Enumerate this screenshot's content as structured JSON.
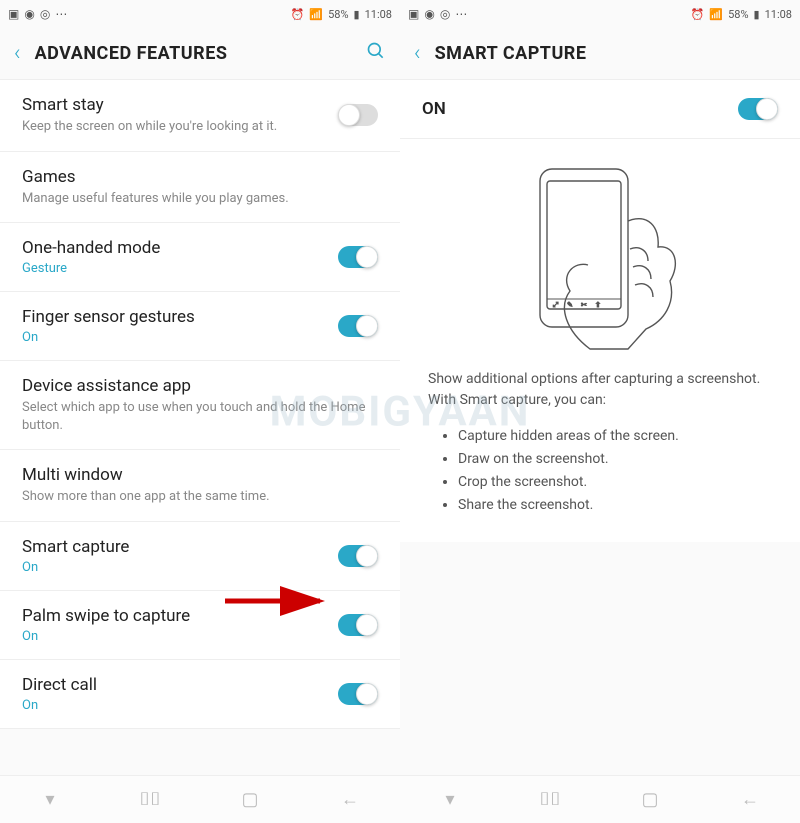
{
  "status": {
    "battery": "58%",
    "time": "11:08"
  },
  "left": {
    "title": "ADVANCED FEATURES",
    "items": [
      {
        "label": "Smart stay",
        "desc": "Keep the screen on while you're looking at it.",
        "toggle": "off"
      },
      {
        "label": "Games",
        "desc": "Manage useful features while you play games."
      },
      {
        "label": "One-handed mode",
        "sub": "Gesture",
        "toggle": "on"
      },
      {
        "label": "Finger sensor gestures",
        "sub": "On",
        "toggle": "on"
      },
      {
        "label": "Device assistance app",
        "desc": "Select which app to use when you touch and hold the Home button."
      },
      {
        "label": "Multi window",
        "desc": "Show more than one app at the same time."
      },
      {
        "label": "Smart capture",
        "sub": "On",
        "toggle": "on"
      },
      {
        "label": "Palm swipe to capture",
        "sub": "On",
        "toggle": "on"
      },
      {
        "label": "Direct call",
        "sub": "On",
        "toggle": "on"
      }
    ]
  },
  "right": {
    "title": "SMART CAPTURE",
    "switch_label": "ON",
    "desc": "Show additional options after capturing a screenshot. With Smart capture, you can:",
    "bullets": [
      "Capture hidden areas of the screen.",
      "Draw on the screenshot.",
      "Crop the screenshot.",
      "Share the screenshot."
    ]
  },
  "watermark": "MOBIGYAAN"
}
